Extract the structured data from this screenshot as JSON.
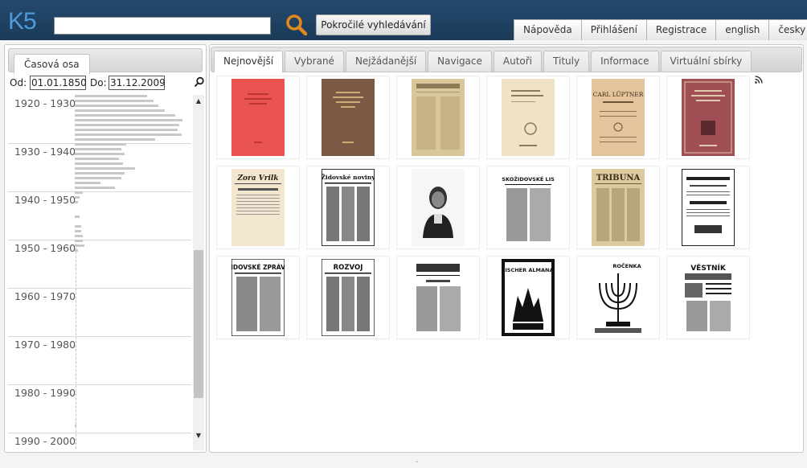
{
  "app": {
    "logo": "K5"
  },
  "search": {
    "value": "",
    "advanced_label": "Pokročilé vyhledávání"
  },
  "topnav": [
    "Nápověda",
    "Přihlášení",
    "Registrace",
    "english",
    "česky"
  ],
  "left": {
    "tab_label": "Časová osa",
    "from_label": "Od:",
    "from_value": "01.01.1850",
    "to_label": "Do:",
    "to_value": "31.12.2009",
    "decades": [
      "1920 - 1930",
      "1930 - 1940",
      "1940 - 1950",
      "1950 - 1960",
      "1960 - 1970",
      "1970 - 1980",
      "1980 - 1990",
      "1990 - 2000"
    ]
  },
  "main": {
    "tabs": [
      "Nejnovější",
      "Vybrané",
      "Nejžádanější",
      "Navigace",
      "Autoři",
      "Tituly",
      "Informace",
      "Virtuální sbírky"
    ],
    "active_tab": 0
  },
  "thumbnail_texts": {
    "t6": "CARL LÜPTNER",
    "t7": "Zora Vrilk",
    "t8": "Židovské noviny",
    "t10": "ČESKOŽIDOVSKÉ LISTY",
    "t11": "TRIBUNA",
    "t13": "ŽIDOVSKÉ ZPRÁVY",
    "t14": "ROZVOJ",
    "t16": "JÜDISCHER ALMANACH",
    "t17": "ROČENKA",
    "t18": "VĚSTNÍK"
  },
  "colors": {
    "header": "#1f4263",
    "logo": "#4d9ce0",
    "accent": "#e08a1e"
  }
}
